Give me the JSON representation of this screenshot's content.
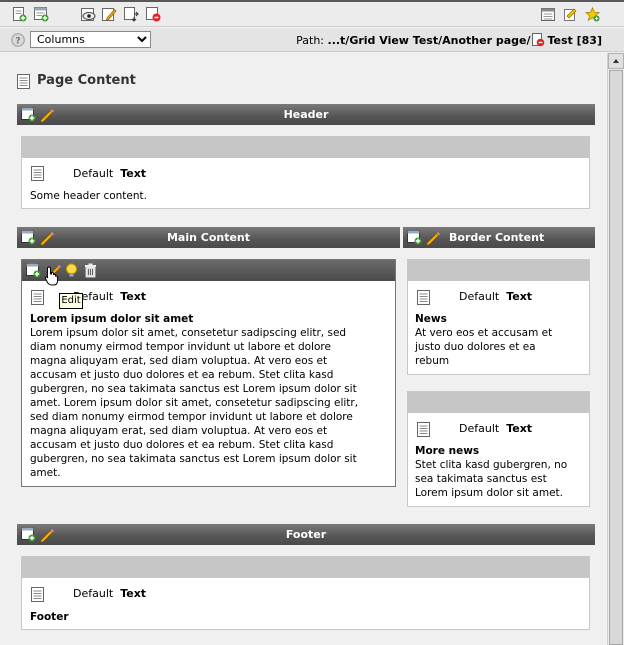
{
  "toolbar": {
    "left_icons": [
      "new-page-icon",
      "new-content-icon",
      "view-page-icon",
      "edit-page-icon",
      "move-page-icon",
      "delete-page-icon"
    ],
    "right_icons": [
      "list-view-icon",
      "clipboard-icon",
      "favorite-icon"
    ]
  },
  "secondbar": {
    "layout_select_value": "Columns",
    "path_label": "Path:",
    "path_value": "...t/Grid View Test/Another page/",
    "page_title": "Test [83]"
  },
  "page_content_title": "Page Content",
  "sections": {
    "header": "Header",
    "main": "Main Content",
    "border": "Border Content",
    "footer": "Footer"
  },
  "elements": {
    "header_el": {
      "type_prefix": "Default",
      "type_name": "Text",
      "body": "Some header content."
    },
    "main_el": {
      "type_prefix": "Default",
      "type_name": "Text",
      "headline": "Lorem ipsum dolor sit amet",
      "lines": [
        "Lorem ipsum dolor sit amet, consetetur sadipscing elitr, sed",
        "diam nonumy eirmod tempor invidunt ut labore et dolore",
        "magna aliquyam erat, sed diam voluptua. At vero eos et",
        "accusam et justo duo dolores et ea rebum. Stet clita kasd",
        "gubergren, no sea takimata sanctus est Lorem ipsum dolor sit",
        "amet. Lorem ipsum dolor sit amet, consetetur sadipscing elitr,",
        "sed diam nonumy eirmod tempor invidunt ut labore et dolore",
        "magna aliquyam erat, sed diam voluptua. At vero eos et",
        "accusam et justo duo dolores et ea rebum. Stet clita kasd",
        "gubergren, no sea takimata sanctus est Lorem ipsum dolor sit",
        "amet."
      ]
    },
    "border_el1": {
      "type_prefix": "Default",
      "type_name": "Text",
      "headline": "News",
      "lines": [
        "At vero eos et accusam et",
        "justo duo dolores et ea",
        "rebum"
      ]
    },
    "border_el2": {
      "type_prefix": "Default",
      "type_name": "Text",
      "headline": "More news",
      "lines": [
        "Stet clita kasd gubergren, no",
        "sea takimata sanctus est",
        "Lorem ipsum dolor sit amet."
      ]
    },
    "footer_el": {
      "type_prefix": "Default",
      "type_name": "Text",
      "headline": "Footer"
    }
  },
  "tooltip": "Edit",
  "colors": {
    "section_bar": "#555555",
    "gray_strip": "#c6c6c6",
    "page_bg": "#f0f0f0"
  }
}
